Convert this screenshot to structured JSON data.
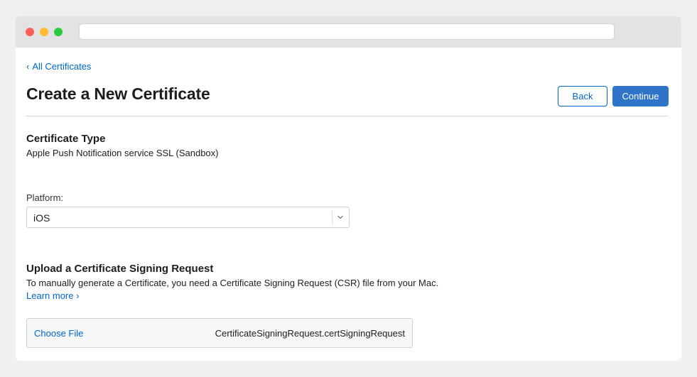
{
  "nav": {
    "back_link": "All Certificates",
    "back_chevron": "‹"
  },
  "page": {
    "title": "Create a New Certificate"
  },
  "actions": {
    "back_label": "Back",
    "continue_label": "Continue"
  },
  "certificate_type": {
    "heading": "Certificate Type",
    "value": "Apple Push Notification service SSL (Sandbox)"
  },
  "platform": {
    "label": "Platform:",
    "selected": "iOS"
  },
  "upload": {
    "heading": "Upload a Certificate Signing Request",
    "description": "To manually generate a Certificate, you need a Certificate Signing Request (CSR) file from your Mac.",
    "learn_more": "Learn more ›",
    "choose_file_label": "Choose File",
    "file_name": "CertificateSigningRequest.certSigningRequest"
  },
  "colors": {
    "accent": "#0066cc",
    "primary_button": "#2f74c8"
  },
  "icons": {
    "select_chevron": "chevron-down-icon",
    "back_chevron": "chevron-left-icon"
  }
}
